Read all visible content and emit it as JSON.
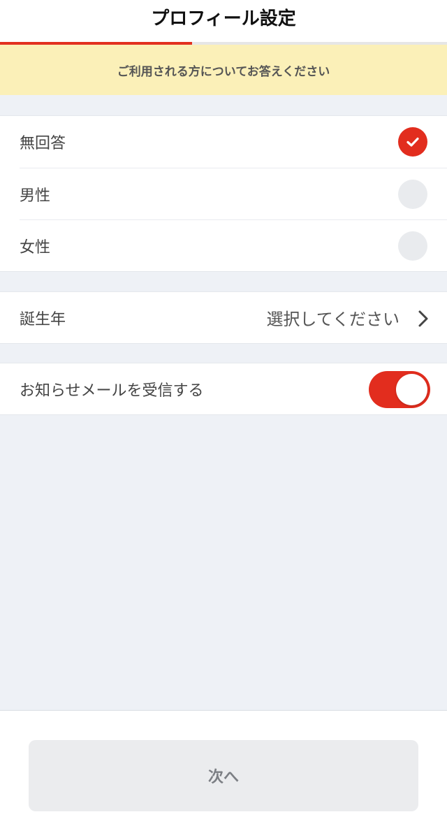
{
  "header": {
    "title": "プロフィール設定"
  },
  "progress": {
    "fraction": 0.43,
    "color": "#e23020"
  },
  "notice": {
    "text": "ご利用される方についてお答えください"
  },
  "gender": {
    "options": [
      {
        "label": "無回答",
        "selected": true
      },
      {
        "label": "男性",
        "selected": false
      },
      {
        "label": "女性",
        "selected": false
      }
    ]
  },
  "birth_year": {
    "label": "誕生年",
    "value": "選択してください",
    "icon": "chevron-right-icon"
  },
  "newsletter": {
    "label": "お知らせメールを受信する",
    "enabled": true
  },
  "footer": {
    "next_label": "次へ"
  },
  "colors": {
    "accent": "#e22d1e",
    "notice_bg": "#fbf0b8",
    "background": "#eef1f6"
  }
}
